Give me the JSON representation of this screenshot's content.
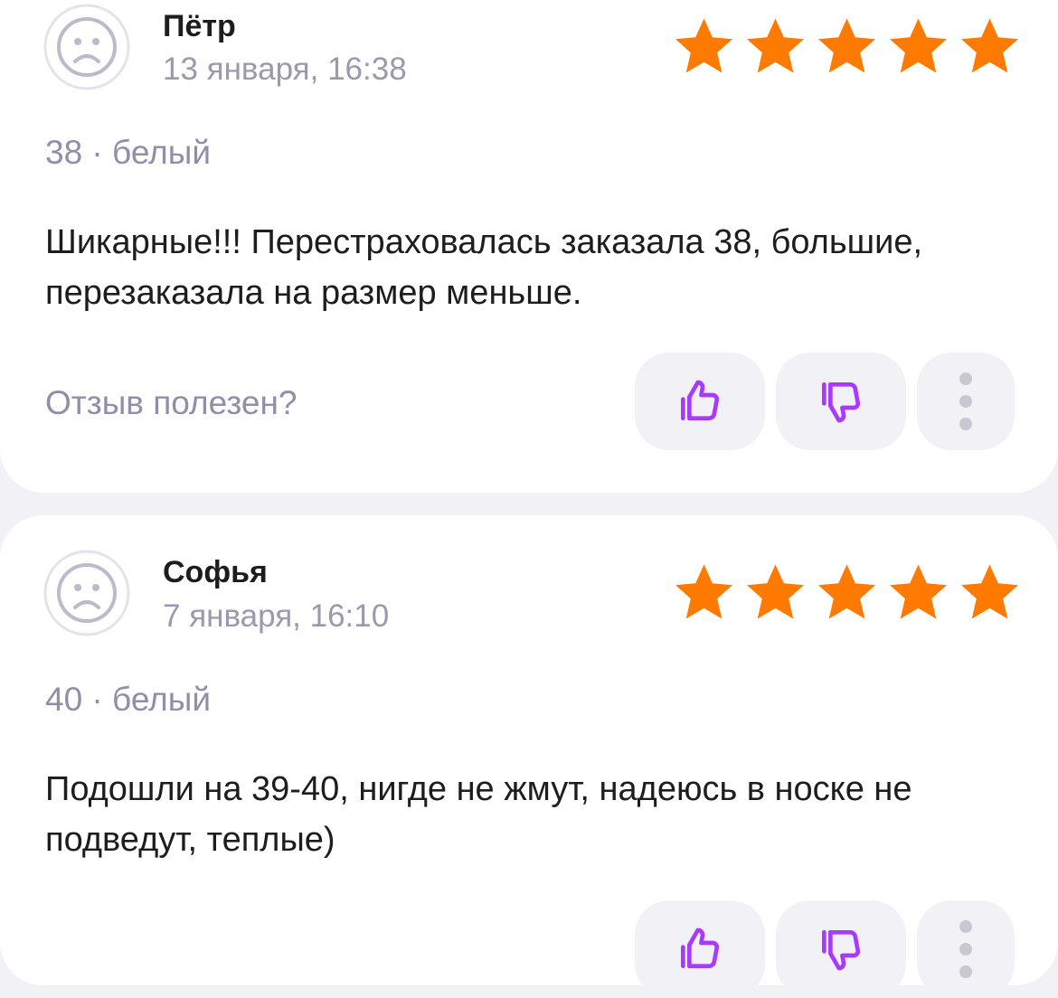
{
  "reviews": [
    {
      "author": "Пётр",
      "date": "13 января, 16:38",
      "rating": 5,
      "variant": "38 · белый",
      "text": "Шикарные!!! Перестраховалась заказала 38, большие, перезаказала на размер меньше.",
      "helpful_label": "Отзыв полезен?"
    },
    {
      "author": "Софья",
      "date": "7 января, 16:10",
      "rating": 5,
      "variant": "40 · белый",
      "text": "Подошли на 39-40, нигде не жмут, надеюсь в носке не подведут, теплые)",
      "helpful_label": ""
    }
  ],
  "icons": {
    "avatar": "sad-face-avatar-icon",
    "star": "star-icon",
    "like": "thumbs-up-icon",
    "dislike": "thumbs-down-icon",
    "more": "more-vertical-icon"
  },
  "colors": {
    "background": "#f2f1f6",
    "card": "#ffffff",
    "star": "#ff7a00",
    "accent": "#a73afd",
    "muted_text": "#9a99ad",
    "text": "#1d1d20"
  }
}
